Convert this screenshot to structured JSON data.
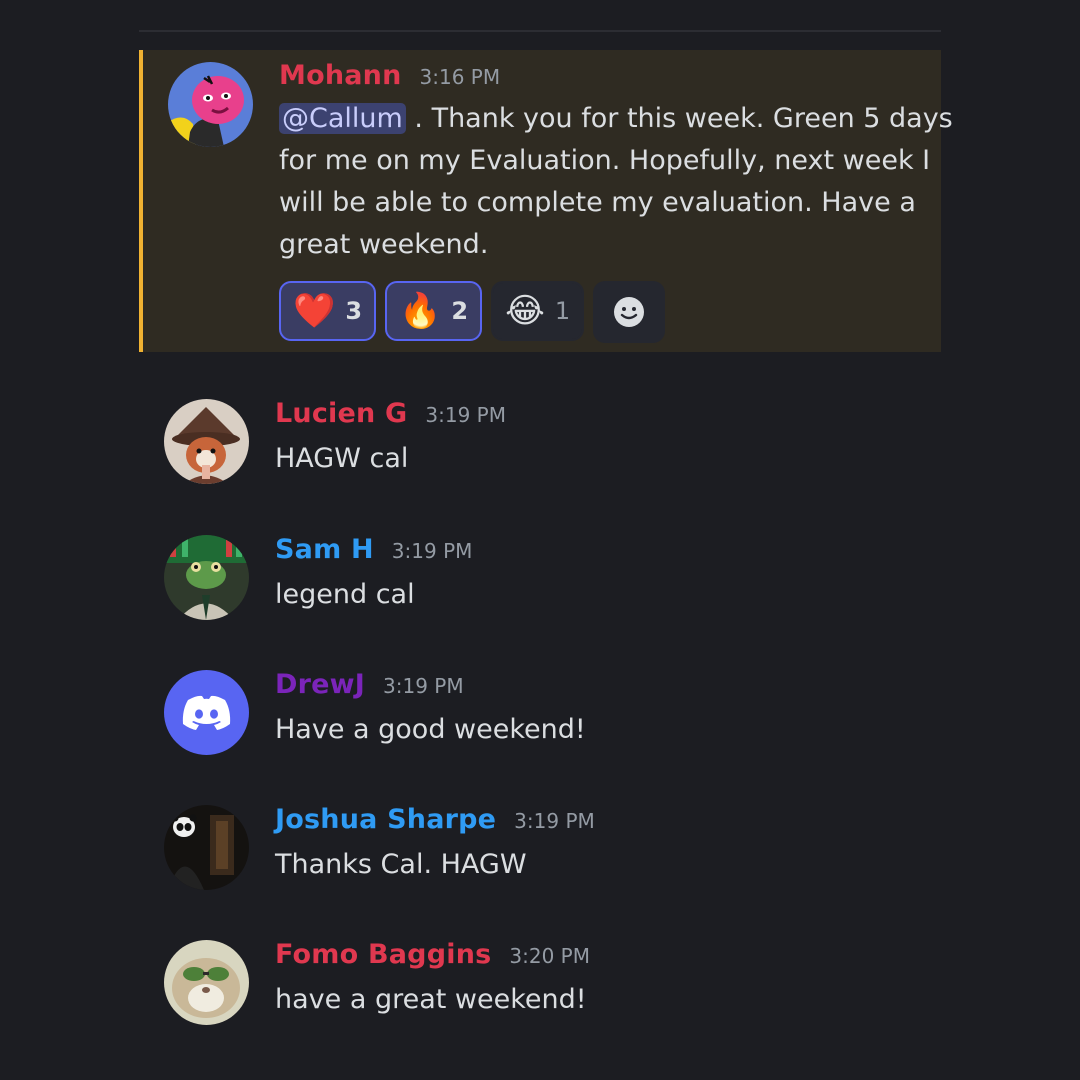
{
  "messages": [
    {
      "username": "Mohann",
      "name_color": "#e0384f",
      "timestamp": "3:16 PM",
      "mention": "@Callum",
      "lines": [
        " . Thank you for this week. Green 5 days",
        "for me on my Evaluation. Hopefully, next week I",
        "will be able to complete my evaluation.  Have a",
        "great weekend."
      ],
      "highlighted": true,
      "reactions": [
        {
          "emoji": "❤️",
          "count": "3",
          "reacted": true
        },
        {
          "emoji": "🔥",
          "count": "2",
          "reacted": true
        },
        {
          "emoji": "😂",
          "count": "1",
          "reacted": false
        }
      ]
    },
    {
      "username": "Lucien G",
      "name_color": "#e0384f",
      "timestamp": "3:19 PM",
      "text": "HAGW cal"
    },
    {
      "username": "Sam H",
      "name_color": "#2f9bf4",
      "timestamp": "3:19 PM",
      "text": "legend cal"
    },
    {
      "username": "DrewJ",
      "name_color": "#7b24ba",
      "timestamp": "3:19 PM",
      "text": "Have a good weekend!"
    },
    {
      "username": "Joshua Sharpe",
      "name_color": "#2f9bf4",
      "timestamp": "3:19 PM",
      "text": "Thanks Cal. HAGW"
    },
    {
      "username": "Fomo Baggins",
      "name_color": "#e0384f",
      "timestamp": "3:20 PM",
      "text": "have a great weekend!"
    }
  ],
  "add_reaction_icon": "smiley-add-reaction-icon",
  "colors": {
    "highlight_bg": "#2f2b22",
    "highlight_bar": "#f0b232",
    "mention_bg": "#3c4270",
    "reaction_active_border": "#5865f2"
  }
}
